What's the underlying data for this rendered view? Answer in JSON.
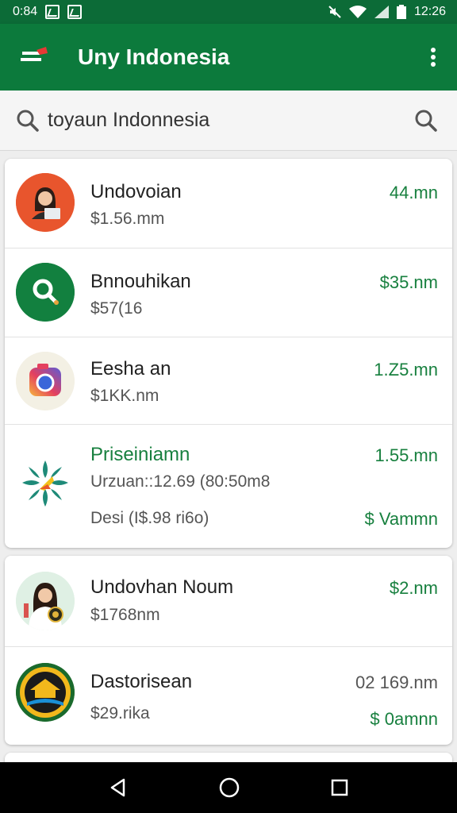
{
  "status_bar": {
    "time_left": "0:84",
    "time_right": "12:26"
  },
  "app_bar": {
    "title": "Uny Indonesia"
  },
  "search": {
    "query": "toyaun Indonnesia"
  },
  "card1": {
    "items": [
      {
        "name": "Undovoian",
        "sub": "$1.56.mm",
        "amount": "44.mn"
      },
      {
        "name": "Bnnouhikan",
        "sub": "$57(16",
        "amount": "$35.nm"
      },
      {
        "name": "Eesha an",
        "sub": "$1KK.nm",
        "amount": "1.Z5.mn"
      },
      {
        "name": "Priseiniamn",
        "sub": "Urzuan::12.69 (80:50m8",
        "amount": "1.55.mn",
        "sub2": "Desi (I$.98 ri6o)",
        "amount2": "$ Vammn"
      }
    ]
  },
  "card2": {
    "items": [
      {
        "name": "Undovhan Noum",
        "sub": "$1768nm",
        "amount": "$2.nm"
      },
      {
        "name": "Dastorisean",
        "sub": "$29.rika",
        "amount": "02 169.nm",
        "amount2": "$ 0amnn"
      }
    ]
  },
  "colors": {
    "brand": "#0c7a3c",
    "status_bar": "#0c6b37",
    "accent_text": "#18803f"
  }
}
